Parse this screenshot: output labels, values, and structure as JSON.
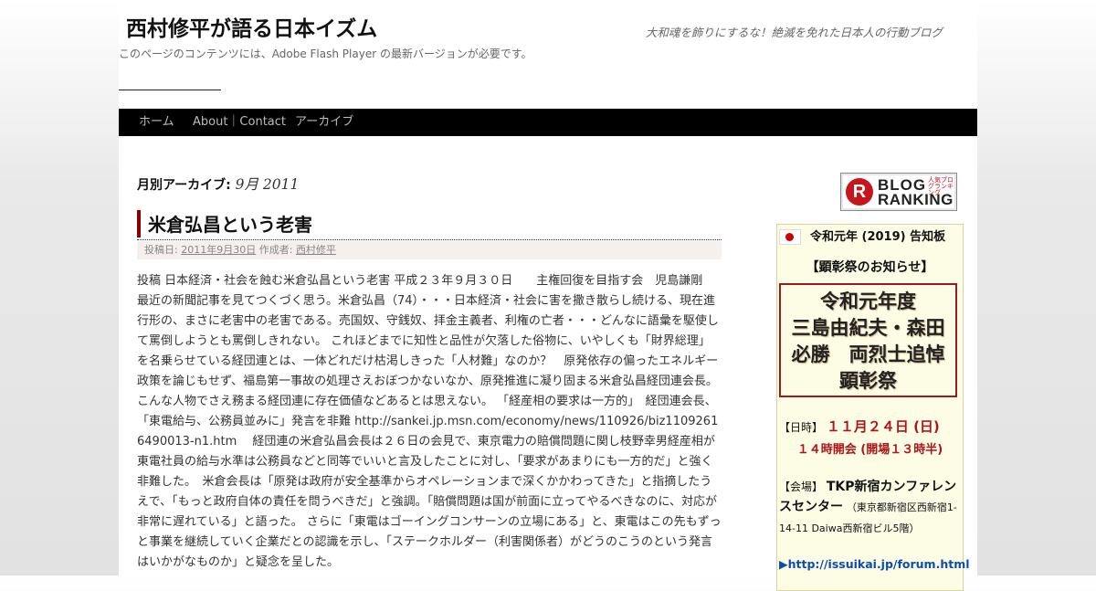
{
  "site": {
    "title": "西村修平が語る日本イズム",
    "description": "大和魂を飾りにするな！絶滅を免れた日本人の行動ブログ",
    "flash_note": "このページのコンテンツには、Adobe Flash Player の最新バージョンが必要です。"
  },
  "nav": {
    "items": [
      {
        "label": "ホーム"
      },
      {
        "label": "About｜Contact"
      },
      {
        "label": "アーカイブ"
      }
    ]
  },
  "archive": {
    "label": "月別アーカイブ:",
    "month": "9月 2011"
  },
  "post": {
    "title": "米倉弘昌という老害",
    "meta_prefix": "投稿日:",
    "date": "2011年9月30日",
    "author_prefix": "作成者:",
    "author": "西村修平",
    "body": "投稿 日本経済・社会を蝕む米倉弘昌という老害 平成２３年９月３０日　　主権回復を目指す会　児島謙剛　　最近の新聞記事を見てつくづく思う。米倉弘昌（74）・・・日本経済・社会に害を撒き散らし続ける、現在進行形の、まさに老害中の老害である。売国奴、守銭奴、拝金主義者、利権の亡者・・・どんなに語彙を駆使して罵倒しようとも罵倒しきれない。 これほどまでに知性と品性が欠落した俗物に、いやしくも「財界総理」を名乗らせている経団連とは、一体どれだけ枯渇しきった「人材難」なのか？　原発依存の偏ったエネルギー政策を論じもせず、福島第一事故の処理さえおぼつかないなか、原発推進に凝り固まる米倉弘昌経団連会長。こんな人物でさえ務まる経団連に存在価値などあるとは思えない。 「経産相の要求は一方的」　経団連会長、「東電給与、公務員並みに」発言を非難 http://sankei.jp.msn.com/economy/news/110926/biz11092616490013-n1.htm　 経団連の米倉弘昌会長は２６日の会見で、東京電力の賠償問題に関し枝野幸男経産相が東電社員の給与水準は公務員などと同等でいいと言及したことに対し、「要求があまりにも一方的だ」と強く非難した。　米倉会長は「原発は政府が安全基準からオペレーションまで深くかかわってきた」と指摘したうえで、「もっと政府自体の責任を問うべきだ」と強調。「賠償問題は国が前面に立ってやるべきなのに、対応が非常に遅れている」と語った。 さらに「東電はゴーイングコンサーンの立場にある」と、東電はこの先もずっと事業を継続していく企業だとの認識を示し、「ステークホルダー（利害関係者）がどうのこうのという発言はいかがなものか」と疑念を呈した。"
  },
  "sidebar": {
    "blog_ranking": {
      "letter": "R",
      "line1": "BLOG",
      "line2": "RANKING",
      "small": "人気ブログランキング"
    },
    "notice": {
      "heading": "令和元年 (2019) 告知板",
      "subheading": "【顕彰祭のお知らせ】",
      "box_line1": "令和元年度",
      "box_line2": "三島由紀夫・森田",
      "box_line3": "必勝　両烈士追悼",
      "box_line4": "顕彰祭",
      "date_label": "【日時】",
      "date": "１１月２４日 (日)",
      "time": "１４時開会 (開場１３時半)",
      "venue_label": "【会場】",
      "venue": "TKP新宿カンファレンスセンター",
      "address": "（東京都新宿区西新宿1-14-11 Daiwa西新宿ビル5階）",
      "link": "▶http://issuikai.jp/forum.html"
    }
  },
  "colors": {
    "nav_bg": "#000000",
    "title_accent": "#880000",
    "date_red": "#b0141b",
    "link_blue": "#0b4eb0"
  }
}
